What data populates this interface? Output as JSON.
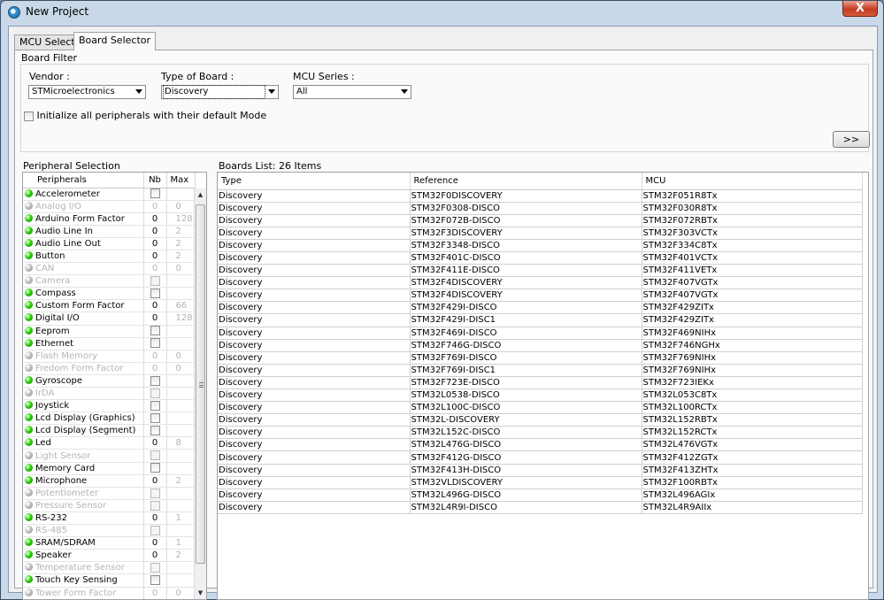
{
  "window": {
    "title": "New Project",
    "close_label": "X"
  },
  "tabs": [
    {
      "label": "MCU Selector",
      "active": false
    },
    {
      "label": "Board Selector",
      "active": true
    }
  ],
  "board_filter": {
    "title": "Board Filter",
    "vendor": {
      "label": "Vendor :",
      "value": "STMicroelectronics"
    },
    "type_of_board": {
      "label": "Type of Board :",
      "value": "Discovery"
    },
    "mcu_series": {
      "label": "MCU Series :",
      "value": "All"
    },
    "init_checkbox_label": "Initialize all peripherals with their default Mode",
    "init_checked": false,
    "next_button": ">>"
  },
  "peripheral_selection": {
    "title": "Peripheral Selection",
    "columns": [
      "Peripherals",
      "Nb",
      "Max"
    ],
    "rows": [
      {
        "name": "Accelerometer",
        "enabled": true,
        "kind": "check",
        "nb": "",
        "max": ""
      },
      {
        "name": "Analog I/O",
        "enabled": false,
        "kind": "num",
        "nb": "0",
        "max": "0"
      },
      {
        "name": "Arduino Form Factor",
        "enabled": true,
        "kind": "num",
        "nb": "0",
        "max": "128"
      },
      {
        "name": "Audio Line In",
        "enabled": true,
        "kind": "num",
        "nb": "0",
        "max": "2"
      },
      {
        "name": "Audio Line Out",
        "enabled": true,
        "kind": "num",
        "nb": "0",
        "max": "2"
      },
      {
        "name": "Button",
        "enabled": true,
        "kind": "num",
        "nb": "0",
        "max": "2"
      },
      {
        "name": "CAN",
        "enabled": false,
        "kind": "num",
        "nb": "0",
        "max": "0"
      },
      {
        "name": "Camera",
        "enabled": false,
        "kind": "check",
        "nb": "",
        "max": ""
      },
      {
        "name": "Compass",
        "enabled": true,
        "kind": "check",
        "nb": "",
        "max": ""
      },
      {
        "name": "Custom Form Factor",
        "enabled": true,
        "kind": "num",
        "nb": "0",
        "max": "66"
      },
      {
        "name": "Digital I/O",
        "enabled": true,
        "kind": "num",
        "nb": "0",
        "max": "128"
      },
      {
        "name": "Eeprom",
        "enabled": true,
        "kind": "check",
        "nb": "",
        "max": ""
      },
      {
        "name": "Ethernet",
        "enabled": true,
        "kind": "check",
        "nb": "",
        "max": ""
      },
      {
        "name": "Flash Memory",
        "enabled": false,
        "kind": "num",
        "nb": "0",
        "max": "0"
      },
      {
        "name": "Fredom Form Factor",
        "enabled": false,
        "kind": "num",
        "nb": "0",
        "max": "0"
      },
      {
        "name": "Gyroscope",
        "enabled": true,
        "kind": "check",
        "nb": "",
        "max": ""
      },
      {
        "name": "IrDA",
        "enabled": false,
        "kind": "check",
        "nb": "",
        "max": ""
      },
      {
        "name": "Joystick",
        "enabled": true,
        "kind": "check",
        "nb": "",
        "max": ""
      },
      {
        "name": "Lcd Display (Graphics)",
        "enabled": true,
        "kind": "check",
        "nb": "",
        "max": ""
      },
      {
        "name": "Lcd Display (Segment)",
        "enabled": true,
        "kind": "check",
        "nb": "",
        "max": ""
      },
      {
        "name": "Led",
        "enabled": true,
        "kind": "num",
        "nb": "0",
        "max": "8"
      },
      {
        "name": "Light Sensor",
        "enabled": false,
        "kind": "check",
        "nb": "",
        "max": ""
      },
      {
        "name": "Memory Card",
        "enabled": true,
        "kind": "check",
        "nb": "",
        "max": ""
      },
      {
        "name": "Microphone",
        "enabled": true,
        "kind": "num",
        "nb": "0",
        "max": "2"
      },
      {
        "name": "Potentiometer",
        "enabled": false,
        "kind": "check",
        "nb": "",
        "max": ""
      },
      {
        "name": "Pressure Sensor",
        "enabled": false,
        "kind": "check",
        "nb": "",
        "max": ""
      },
      {
        "name": "RS-232",
        "enabled": true,
        "kind": "num",
        "nb": "0",
        "max": "1"
      },
      {
        "name": "RS-485",
        "enabled": false,
        "kind": "check",
        "nb": "",
        "max": ""
      },
      {
        "name": "SRAM/SDRAM",
        "enabled": true,
        "kind": "num",
        "nb": "0",
        "max": "1"
      },
      {
        "name": "Speaker",
        "enabled": true,
        "kind": "num",
        "nb": "0",
        "max": "2"
      },
      {
        "name": "Temperature Sensor",
        "enabled": false,
        "kind": "check",
        "nb": "",
        "max": ""
      },
      {
        "name": "Touch Key Sensing",
        "enabled": true,
        "kind": "check",
        "nb": "",
        "max": ""
      },
      {
        "name": "Tower Form Factor",
        "enabled": false,
        "kind": "num",
        "nb": "0",
        "max": "0"
      }
    ]
  },
  "boards_list": {
    "title": "Boards List: 26 Items",
    "columns": [
      "Type",
      "Reference",
      "MCU"
    ],
    "rows": [
      [
        "Discovery",
        "STM32F0DISCOVERY",
        "STM32F051R8Tx"
      ],
      [
        "Discovery",
        "STM32F0308-DISCO",
        "STM32F030R8Tx"
      ],
      [
        "Discovery",
        "STM32F072B-DISCO",
        "STM32F072RBTx"
      ],
      [
        "Discovery",
        "STM32F3DISCOVERY",
        "STM32F303VCTx"
      ],
      [
        "Discovery",
        "STM32F3348-DISCO",
        "STM32F334C8Tx"
      ],
      [
        "Discovery",
        "STM32F401C-DISCO",
        "STM32F401VCTx"
      ],
      [
        "Discovery",
        "STM32F411E-DISCO",
        "STM32F411VETx"
      ],
      [
        "Discovery",
        "STM32F4DISCOVERY",
        "STM32F407VGTx"
      ],
      [
        "Discovery",
        "STM32F4DISCOVERY",
        "STM32F407VGTx"
      ],
      [
        "Discovery",
        "STM32F429I-DISCO",
        "STM32F429ZITx"
      ],
      [
        "Discovery",
        "STM32F429I-DISC1",
        "STM32F429ZITx"
      ],
      [
        "Discovery",
        "STM32F469I-DISCO",
        "STM32F469NIHx"
      ],
      [
        "Discovery",
        "STM32F746G-DISCO",
        "STM32F746NGHx"
      ],
      [
        "Discovery",
        "STM32F769I-DISCO",
        "STM32F769NIHx"
      ],
      [
        "Discovery",
        "STM32F769I-DISC1",
        "STM32F769NIHx"
      ],
      [
        "Discovery",
        "STM32F723E-DISCO",
        "STM32F723IEKx"
      ],
      [
        "Discovery",
        "STM32L0538-DISCO",
        "STM32L053C8Tx"
      ],
      [
        "Discovery",
        "STM32L100C-DISCO",
        "STM32L100RCTx"
      ],
      [
        "Discovery",
        "STM32L-DISCOVERY",
        "STM32L152RBTx"
      ],
      [
        "Discovery",
        "STM32L152C-DISCO",
        "STM32L152RCTx"
      ],
      [
        "Discovery",
        "STM32L476G-DISCO",
        "STM32L476VGTx"
      ],
      [
        "Discovery",
        "STM32F412G-DISCO",
        "STM32F412ZGTx"
      ],
      [
        "Discovery",
        "STM32F413H-DISCO",
        "STM32F413ZHTx"
      ],
      [
        "Discovery",
        "STM32VLDISCOVERY",
        "STM32F100RBTx"
      ],
      [
        "Discovery",
        "STM32L496G-DISCO",
        "STM32L496AGIx"
      ],
      [
        "Discovery",
        "STM32L4R9I-DISCO",
        "STM32L4R9AIIx"
      ]
    ]
  }
}
